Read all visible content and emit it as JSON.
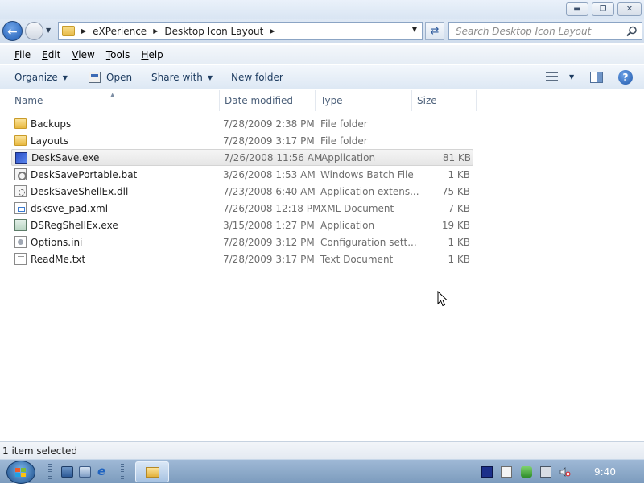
{
  "window": {
    "caption_buttons": {
      "minimize": "▬",
      "maximize": "❐",
      "close": "✕"
    }
  },
  "address_bar": {
    "breadcrumbs": [
      "eXPerience",
      "Desktop Icon Layout"
    ],
    "separator": "▶",
    "dropdown": "▼"
  },
  "search": {
    "placeholder": "Search Desktop Icon Layout"
  },
  "menu": {
    "items": [
      "File",
      "Edit",
      "View",
      "Tools",
      "Help"
    ]
  },
  "toolbar": {
    "organize": "Organize",
    "open": "Open",
    "share_with": "Share with",
    "new_folder": "New folder",
    "help": "?",
    "caret": "▼"
  },
  "columns": {
    "name": "Name",
    "date_modified": "Date modified",
    "type": "Type",
    "size": "Size",
    "sort_indicator": "▲"
  },
  "files": [
    {
      "name": "Backups",
      "date": "7/28/2009 2:38 PM",
      "type": "File folder",
      "size": "",
      "icon": "folder-icon"
    },
    {
      "name": "Layouts",
      "date": "7/28/2009 3:17 PM",
      "type": "File folder",
      "size": "",
      "icon": "folder-icon"
    },
    {
      "name": "DeskSave.exe",
      "date": "7/26/2008 11:56 AM",
      "type": "Application",
      "size": "81 KB",
      "icon": "application-icon",
      "selected": true
    },
    {
      "name": "DeskSavePortable.bat",
      "date": "3/26/2008 1:53 AM",
      "type": "Windows Batch File",
      "size": "1 KB",
      "icon": "batch-file-icon"
    },
    {
      "name": "DeskSaveShellEx.dll",
      "date": "7/23/2008 6:40 AM",
      "type": "Application extens...",
      "size": "75 KB",
      "icon": "dll-file-icon"
    },
    {
      "name": "dsksve_pad.xml",
      "date": "7/26/2008 12:18 PM",
      "type": "XML Document",
      "size": "7 KB",
      "icon": "xml-file-icon"
    },
    {
      "name": "DSRegShellEx.exe",
      "date": "3/15/2008 1:27 PM",
      "type": "Application",
      "size": "19 KB",
      "icon": "application-icon"
    },
    {
      "name": "Options.ini",
      "date": "7/28/2009 3:12 PM",
      "type": "Configuration sett...",
      "size": "1 KB",
      "icon": "settings-file-icon"
    },
    {
      "name": "ReadMe.txt",
      "date": "7/28/2009 3:17 PM",
      "type": "Text Document",
      "size": "1 KB",
      "icon": "text-file-icon"
    }
  ],
  "status": {
    "text": "1 item selected"
  },
  "taskbar": {
    "clock": "9:40"
  },
  "colors": {
    "accent": "#1d5bb3",
    "taskbar": "#8eaacb",
    "selection": "#e8e8e8"
  }
}
